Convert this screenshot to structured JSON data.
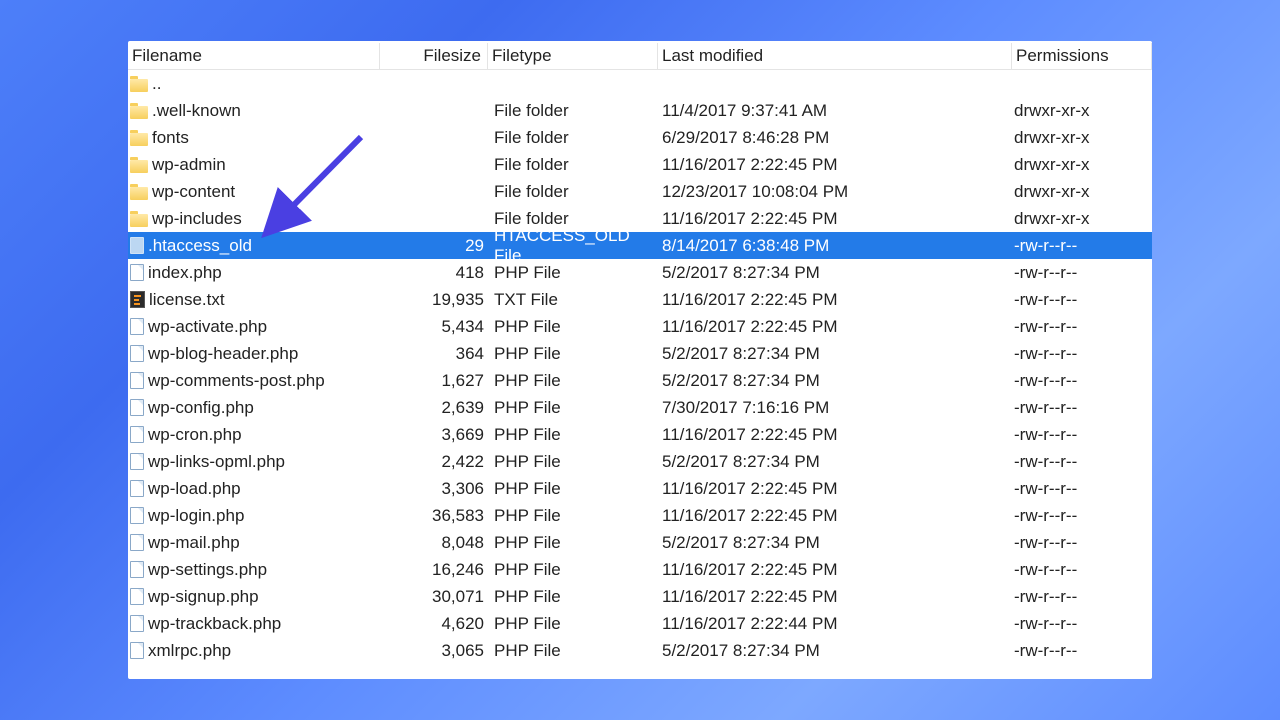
{
  "columns": {
    "name": "Filename",
    "size": "Filesize",
    "type": "Filetype",
    "mod": "Last modified",
    "perm": "Permissions"
  },
  "rows": [
    {
      "icon": "folder",
      "name": "..",
      "size": "",
      "type": "",
      "mod": "",
      "perm": "",
      "selected": false
    },
    {
      "icon": "folder",
      "name": ".well-known",
      "size": "",
      "type": "File folder",
      "mod": "11/4/2017 9:37:41 AM",
      "perm": "drwxr-xr-x",
      "selected": false
    },
    {
      "icon": "folder",
      "name": "fonts",
      "size": "",
      "type": "File folder",
      "mod": "6/29/2017 8:46:28 PM",
      "perm": "drwxr-xr-x",
      "selected": false
    },
    {
      "icon": "folder",
      "name": "wp-admin",
      "size": "",
      "type": "File folder",
      "mod": "11/16/2017 2:22:45 PM",
      "perm": "drwxr-xr-x",
      "selected": false
    },
    {
      "icon": "folder",
      "name": "wp-content",
      "size": "",
      "type": "File folder",
      "mod": "12/23/2017 10:08:04 PM",
      "perm": "drwxr-xr-x",
      "selected": false
    },
    {
      "icon": "folder",
      "name": "wp-includes",
      "size": "",
      "type": "File folder",
      "mod": "11/16/2017 2:22:45 PM",
      "perm": "drwxr-xr-x",
      "selected": false
    },
    {
      "icon": "file-sel",
      "name": ".htaccess_old",
      "size": "29",
      "type": "HTACCESS_OLD File",
      "mod": "8/14/2017 6:38:48 PM",
      "perm": "-rw-r--r--",
      "selected": true
    },
    {
      "icon": "file",
      "name": "index.php",
      "size": "418",
      "type": "PHP File",
      "mod": "5/2/2017 8:27:34 PM",
      "perm": "-rw-r--r--",
      "selected": false
    },
    {
      "icon": "txt",
      "name": "license.txt",
      "size": "19,935",
      "type": "TXT File",
      "mod": "11/16/2017 2:22:45 PM",
      "perm": "-rw-r--r--",
      "selected": false
    },
    {
      "icon": "file",
      "name": "wp-activate.php",
      "size": "5,434",
      "type": "PHP File",
      "mod": "11/16/2017 2:22:45 PM",
      "perm": "-rw-r--r--",
      "selected": false
    },
    {
      "icon": "file",
      "name": "wp-blog-header.php",
      "size": "364",
      "type": "PHP File",
      "mod": "5/2/2017 8:27:34 PM",
      "perm": "-rw-r--r--",
      "selected": false
    },
    {
      "icon": "file",
      "name": "wp-comments-post.php",
      "size": "1,627",
      "type": "PHP File",
      "mod": "5/2/2017 8:27:34 PM",
      "perm": "-rw-r--r--",
      "selected": false
    },
    {
      "icon": "file",
      "name": "wp-config.php",
      "size": "2,639",
      "type": "PHP File",
      "mod": "7/30/2017 7:16:16 PM",
      "perm": "-rw-r--r--",
      "selected": false
    },
    {
      "icon": "file",
      "name": "wp-cron.php",
      "size": "3,669",
      "type": "PHP File",
      "mod": "11/16/2017 2:22:45 PM",
      "perm": "-rw-r--r--",
      "selected": false
    },
    {
      "icon": "file",
      "name": "wp-links-opml.php",
      "size": "2,422",
      "type": "PHP File",
      "mod": "5/2/2017 8:27:34 PM",
      "perm": "-rw-r--r--",
      "selected": false
    },
    {
      "icon": "file",
      "name": "wp-load.php",
      "size": "3,306",
      "type": "PHP File",
      "mod": "11/16/2017 2:22:45 PM",
      "perm": "-rw-r--r--",
      "selected": false
    },
    {
      "icon": "file",
      "name": "wp-login.php",
      "size": "36,583",
      "type": "PHP File",
      "mod": "11/16/2017 2:22:45 PM",
      "perm": "-rw-r--r--",
      "selected": false
    },
    {
      "icon": "file",
      "name": "wp-mail.php",
      "size": "8,048",
      "type": "PHP File",
      "mod": "5/2/2017 8:27:34 PM",
      "perm": "-rw-r--r--",
      "selected": false
    },
    {
      "icon": "file",
      "name": "wp-settings.php",
      "size": "16,246",
      "type": "PHP File",
      "mod": "11/16/2017 2:22:45 PM",
      "perm": "-rw-r--r--",
      "selected": false
    },
    {
      "icon": "file",
      "name": "wp-signup.php",
      "size": "30,071",
      "type": "PHP File",
      "mod": "11/16/2017 2:22:45 PM",
      "perm": "-rw-r--r--",
      "selected": false
    },
    {
      "icon": "file",
      "name": "wp-trackback.php",
      "size": "4,620",
      "type": "PHP File",
      "mod": "11/16/2017 2:22:44 PM",
      "perm": "-rw-r--r--",
      "selected": false
    },
    {
      "icon": "file",
      "name": "xmlrpc.php",
      "size": "3,065",
      "type": "PHP File",
      "mod": "5/2/2017 8:27:34 PM",
      "perm": "-rw-r--r--",
      "selected": false
    }
  ],
  "annotation": {
    "kind": "arrow",
    "color": "#4a3fe2"
  }
}
